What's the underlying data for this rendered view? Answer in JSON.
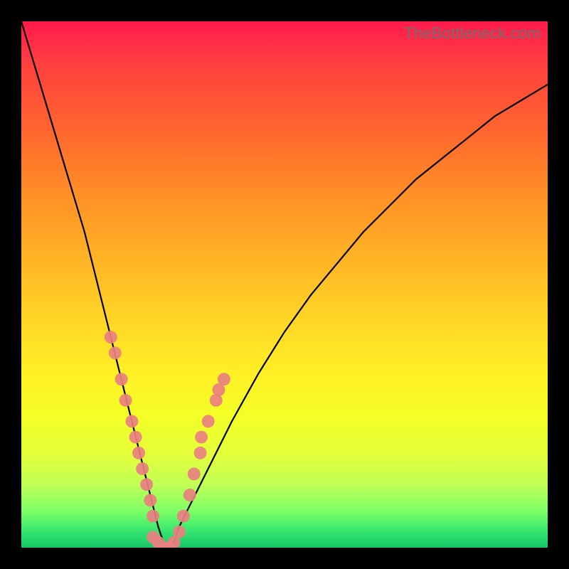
{
  "watermark": "TheBottleneck.com",
  "chart_data": {
    "type": "line",
    "title": "",
    "xlabel": "",
    "ylabel": "",
    "xlim": [
      0,
      100
    ],
    "ylim": [
      0,
      100
    ],
    "grid": false,
    "legend": false,
    "series": [
      {
        "name": "bottleneck-curve",
        "x": [
          0,
          3,
          6,
          9,
          12,
          15,
          17,
          19,
          20,
          21,
          22,
          23,
          24,
          25,
          26,
          27,
          28,
          29,
          30,
          32,
          35,
          40,
          45,
          50,
          55,
          60,
          65,
          70,
          75,
          80,
          85,
          90,
          95,
          100
        ],
        "y": [
          100,
          90,
          80,
          70,
          60,
          48,
          40,
          32,
          28,
          24,
          20,
          16,
          12,
          8,
          4,
          1,
          0,
          1,
          4,
          8,
          14,
          24,
          33,
          41,
          48,
          54,
          60,
          65,
          70,
          74,
          78,
          82,
          85,
          88
        ]
      }
    ],
    "markers": [
      {
        "x": 17.0,
        "y": 40
      },
      {
        "x": 17.8,
        "y": 37
      },
      {
        "x": 19.0,
        "y": 32
      },
      {
        "x": 19.8,
        "y": 28
      },
      {
        "x": 21.0,
        "y": 24
      },
      {
        "x": 21.7,
        "y": 21
      },
      {
        "x": 22.3,
        "y": 18
      },
      {
        "x": 23.0,
        "y": 15
      },
      {
        "x": 23.8,
        "y": 12
      },
      {
        "x": 24.5,
        "y": 9
      },
      {
        "x": 25.0,
        "y": 6
      },
      {
        "x": 25.0,
        "y": 2
      },
      {
        "x": 26.0,
        "y": 1
      },
      {
        "x": 27.0,
        "y": 0
      },
      {
        "x": 28.0,
        "y": 0
      },
      {
        "x": 29.0,
        "y": 1
      },
      {
        "x": 30.0,
        "y": 3
      },
      {
        "x": 30.8,
        "y": 6
      },
      {
        "x": 32.0,
        "y": 10
      },
      {
        "x": 32.8,
        "y": 14
      },
      {
        "x": 34.0,
        "y": 18
      },
      {
        "x": 34.2,
        "y": 21
      },
      {
        "x": 35.5,
        "y": 24
      },
      {
        "x": 37.0,
        "y": 28
      },
      {
        "x": 37.5,
        "y": 30
      },
      {
        "x": 38.5,
        "y": 32
      }
    ],
    "background_gradient": {
      "top": "#ff1a4d",
      "mid": "#fff026",
      "bottom": "#17c565"
    }
  }
}
